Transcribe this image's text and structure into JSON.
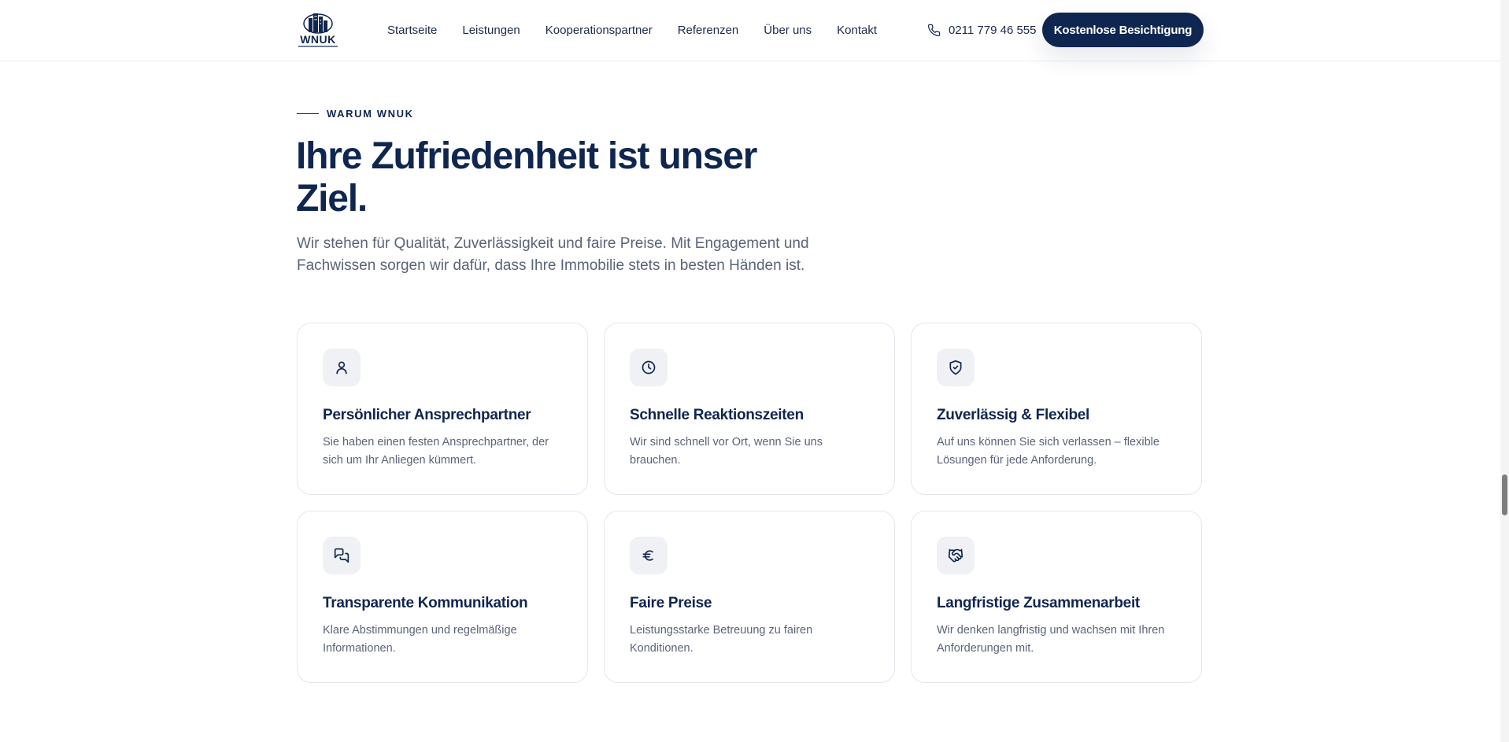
{
  "header": {
    "logo_text": "WNUK",
    "nav": [
      "Startseite",
      "Leistungen",
      "Kooperationspartner",
      "Referenzen",
      "Über uns",
      "Kontakt"
    ],
    "phone": "0211 779 46 555",
    "cta_label": "Kostenlose Besichtigung"
  },
  "intro": {
    "eyebrow": "WARUM WNUK",
    "headline": "Ihre Zufriedenheit ist unser Ziel.",
    "lead": "Wir stehen für Qualität, Zuverlässigkeit und faire Preise. Mit Engagement und Fachwissen sorgen wir dafür, dass Ihre Immobilie stets in besten Händen ist."
  },
  "cards": [
    {
      "icon": "user-icon",
      "title": "Persönlicher Ansprechpartner",
      "text": "Sie haben einen festen Ansprechpartner, der sich um Ihr Anliegen kümmert."
    },
    {
      "icon": "clock-icon",
      "title": "Schnelle Reaktionszeiten",
      "text": "Wir sind schnell vor Ort, wenn Sie uns brauchen."
    },
    {
      "icon": "shield-check-icon",
      "title": "Zuverlässig & Flexibel",
      "text": "Auf uns können Sie sich verlassen – flexible Lösungen für jede Anforderung."
    },
    {
      "icon": "chat-icon",
      "title": "Transparente Kommunikation",
      "text": "Klare Abstimmungen und regelmäßige Informationen."
    },
    {
      "icon": "euro-icon",
      "title": "Faire Preise",
      "text": "Leistungsstarke Betreuung zu fairen Konditionen."
    },
    {
      "icon": "handshake-icon",
      "title": "Langfristige Zusammenarbeit",
      "text": "Wir denken langfristig und wachsen mit Ihren Anforderungen mit."
    }
  ],
  "colors": {
    "brand": "#0f2650",
    "text_muted": "#5a6478",
    "card_border": "#e3e6ec",
    "icon_bg": "#eff1f5"
  }
}
